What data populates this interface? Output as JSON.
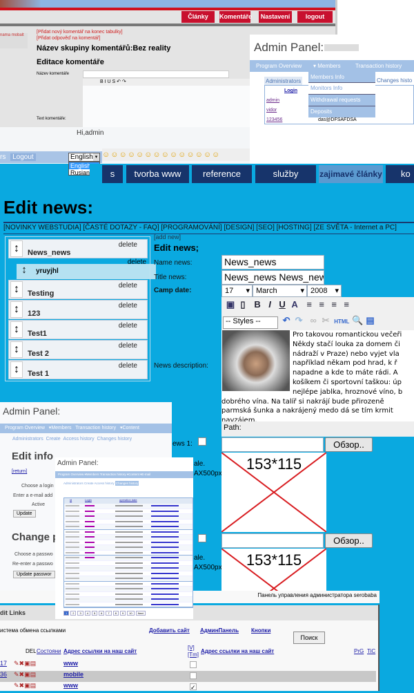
{
  "czech_admin": {
    "buttons": [
      "Články",
      "Komentáře",
      "Nastavení",
      "logout"
    ],
    "links": [
      "[Přidat nový komentář na konec tabulky]",
      "[Přidat odpověď na komentář]"
    ],
    "group_title": "Název skupiny komentářů:Bez reality",
    "edit_title": "Editace komentáře",
    "name_label": "Název komentáře",
    "text_label": "Text komentáře:",
    "tabs": [
      "nama",
      "mobalt"
    ]
  },
  "admin_panel_1": {
    "title": "Admin Panel:",
    "nav": [
      "Program Overview",
      "Members",
      "Transaction history"
    ],
    "dropdown": [
      "Members Info",
      "Monitors Info",
      "Withdrawal requests",
      "Deposits"
    ],
    "tabs": [
      "Administrators",
      "Changes histo"
    ],
    "table_header": "Login",
    "rows": [
      {
        "login": "admin",
        "email": ""
      },
      {
        "login": "vidor",
        "email": ""
      },
      {
        "login": "123456",
        "email": "das@DFSAFDSA"
      }
    ]
  },
  "greeting": "Hi,admin",
  "lang_bar": {
    "prefix": "rs",
    "logout": "Logout",
    "selected": "English",
    "options": [
      "English",
      "Rusian"
    ]
  },
  "emoji_count": 14,
  "site_nav": [
    "s",
    "tvorba www",
    "reference",
    "služby",
    "zajimavé články",
    "ko"
  ],
  "site_nav_active": 4,
  "page_title": "Edit news:",
  "categories": "[NOVINKY WEBSTUDIA] [ČASTÉ DOTAZY - FAQ] [PROGRAMOVÁNÍ] [DESIGN] [SEO] [HOSTING] [ZE SVĚTA - Internet a PC]",
  "news_list": {
    "delete_label": "delete",
    "items": [
      "News_news",
      "Testing",
      "123",
      "Test1",
      "Test 2",
      "Test 1"
    ],
    "dragging": "yruyjhl"
  },
  "form": {
    "add_new": "[add new]",
    "heading": "Edit news;",
    "name_label": "Name news:",
    "name_value": "News_news",
    "title_label": "Title news:",
    "title_value": "News_news News_news",
    "date_label": "Camp date:",
    "day": "17",
    "month": "March",
    "year": "2008",
    "styles": "-- Styles --",
    "desc_label": "News description:",
    "description": "Pro takovou romantickou večeři Někdy stačí louka za domem či nádraží v Praze)  nebo vyjet vla například někam  pod hrad, k ř napadne a kde to máte rádi. A košíkem či sportovní taškou: úp nejlépe jablka, hroznové víno, b dobrého vína. Na talíř si nakrájí bude přirozeně parmská šunka a nakrájený medo dá se tím krmit navzájem.",
    "path_label": "Path:",
    "browse": "Обзор..",
    "placeholder_size": "153*115",
    "news1_label": "ews 1:",
    "scale_label": "ale.",
    "max_label": "AX500px"
  },
  "admin_panel_2": {
    "title": "Admin Panel:",
    "nav": [
      "Program Overview",
      "Members",
      "Transaction history",
      "Content"
    ],
    "subnav": [
      "Administrators",
      "Create",
      "Access history",
      "Changes history"
    ],
    "heading": "Edit info",
    "return": "[return]",
    "fields": [
      "Choose a login",
      "Enter a e-mail add",
      "Active"
    ],
    "update": "Update",
    "heading2": "Change p",
    "fields2": [
      "Choose a passwo",
      "Re-enter a passwo"
    ],
    "update_password": "Update passwor"
  },
  "admin_panel_3": {
    "title": "Admin Panel:",
    "nav": [
      "Program Overview",
      "Members",
      "Transaction history",
      "Content",
      "E-mail"
    ],
    "subnav": [
      "Administrators",
      "Create",
      "Access history",
      "Changes history"
    ],
    "columns": [
      "id",
      "Login",
      "operation date"
    ],
    "pages": [
      "1",
      "2",
      "3",
      "4",
      "5",
      "6",
      "7",
      "8",
      "9",
      "10",
      "Next"
    ]
  },
  "russian_panel": {
    "header": "Панель управления администратора serobaba",
    "section": "dit Links",
    "subtitle": "истема обмена ссылками",
    "links": [
      "Добавить сайт",
      "АдминПанель",
      "Кнопки"
    ],
    "search": "Поиск",
    "columns": [
      "DEL",
      "Состояни",
      "Адрес ссылки на наш сайт",
      "[V]",
      "[Tm]",
      "Адрес ссылки на наш сайт",
      "PrG",
      "TiC"
    ],
    "rows": [
      {
        "id": "17",
        "url": "www"
      },
      {
        "id": "36",
        "url": "mobile"
      },
      {
        "id": "",
        "url": "www"
      }
    ]
  }
}
